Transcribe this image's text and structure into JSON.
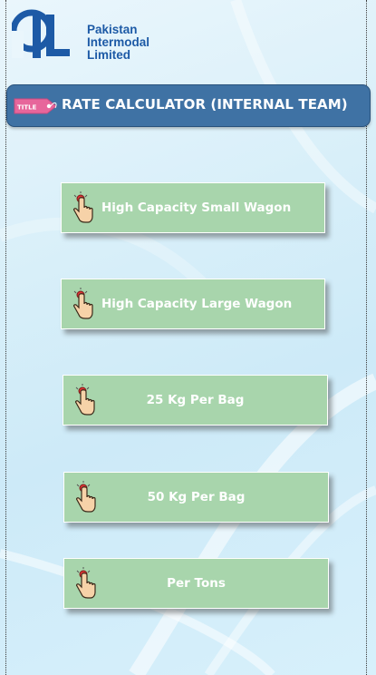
{
  "logo": {
    "line1": "Pakistan",
    "line2": "Intermodal",
    "line3": "Limited"
  },
  "header": {
    "tag_text": "TITLE",
    "title": "RATE CALCULATOR (INTERNAL TEAM)"
  },
  "buttons": [
    {
      "label": "High Capacity Small Wagon",
      "icon": "tap-hand-icon"
    },
    {
      "label": "High Capacity Large Wagon",
      "icon": "tap-hand-icon"
    },
    {
      "label": "25 Kg Per Bag",
      "icon": "tap-hand-icon"
    },
    {
      "label": "50 Kg Per Bag",
      "icon": "tap-hand-icon"
    },
    {
      "label": "Per Tons",
      "icon": "tap-hand-icon"
    }
  ],
  "colors": {
    "title_bar": "#3f72a4",
    "button_fill": "#a8d5ac",
    "logo_blue": "#1d5aa6"
  }
}
